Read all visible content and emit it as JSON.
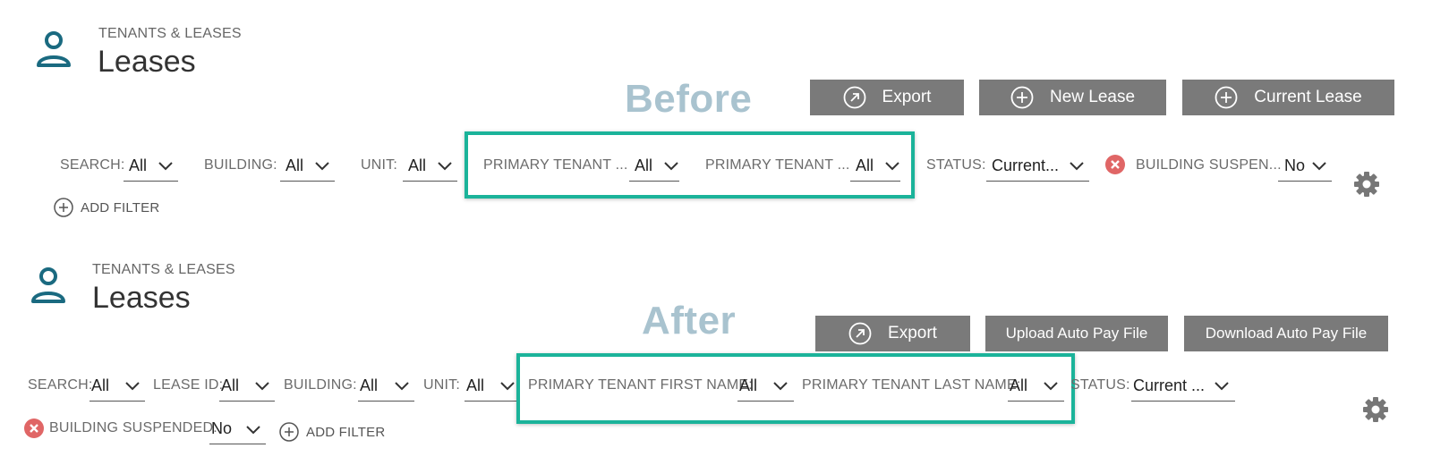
{
  "before": {
    "breadcrumb": "TENANTS & LEASES",
    "title": "Leases",
    "annotation": "Before",
    "buttons": {
      "export": "Export",
      "new_lease": "New Lease",
      "current_lease": "Current Lease"
    },
    "filters": {
      "search": {
        "label": "SEARCH:",
        "value": "All"
      },
      "building": {
        "label": "BUILDING:",
        "value": "All"
      },
      "unit": {
        "label": "UNIT:",
        "value": "All"
      },
      "tenant_first": {
        "label": "PRIMARY TENANT ...",
        "value": "All"
      },
      "tenant_last": {
        "label": "PRIMARY TENANT ...",
        "value": "All"
      },
      "status": {
        "label": "STATUS:",
        "value": "Current..."
      },
      "suspended": {
        "label": "BUILDING SUSPEN...",
        "value": "No"
      }
    },
    "add_filter": "ADD FILTER"
  },
  "after": {
    "breadcrumb": "TENANTS & LEASES",
    "title": "Leases",
    "annotation": "After",
    "buttons": {
      "export": "Export",
      "upload": "Upload Auto Pay File",
      "download": "Download Auto Pay File"
    },
    "filters": {
      "search": {
        "label": "SEARCH:",
        "value": "All"
      },
      "lease_id": {
        "label": "LEASE ID:",
        "value": "All"
      },
      "building": {
        "label": "BUILDING:",
        "value": "All"
      },
      "unit": {
        "label": "UNIT:",
        "value": "All"
      },
      "tenant_first": {
        "label": "PRIMARY TENANT FIRST NAME:",
        "value": "All"
      },
      "tenant_last": {
        "label": "PRIMARY TENANT LAST NAME:",
        "value": "All"
      },
      "status": {
        "label": "STATUS:",
        "value": "Current ..."
      },
      "suspended": {
        "label": "BUILDING SUSPENDED:",
        "value": "No"
      }
    },
    "add_filter": "ADD FILTER"
  },
  "colors": {
    "icon_teal": "#1a6a80",
    "button_gray": "#7a7a7a",
    "highlight": "#1bb39a",
    "annotation": "#a9c3cf",
    "remove_red": "#e06666"
  }
}
